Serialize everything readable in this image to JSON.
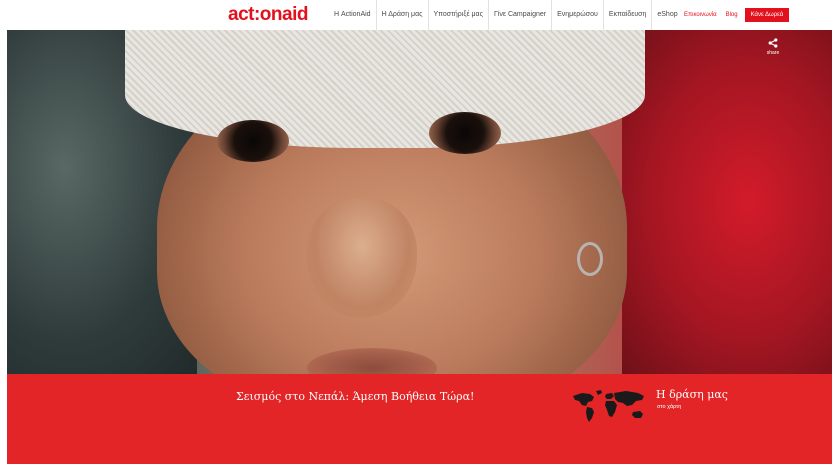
{
  "header": {
    "logo_text": "act:onaid",
    "nav": [
      "Η ActionAid",
      "Η Δράση μας",
      "Υποστήριξέ μας",
      "Γίνε Campaigner",
      "Ενημερώσου",
      "Εκπαίδευση",
      "eShop"
    ],
    "right_links": [
      "Επικοινωνία",
      "Blog"
    ],
    "donate_label": "Κάνε Δωρεά"
  },
  "hero": {
    "share_label": "share",
    "image_subject": "close-up of child with bandaged head"
  },
  "band": {
    "headline": "Σεισμός στο Νεπάλ: Άμεση Βοήθεια Τώρα!",
    "map_title": "Η δράση μας",
    "map_subtitle": "στο χάρτη"
  },
  "colors": {
    "brand_red": "#e3101d",
    "band_red": "#e42527",
    "nav_text": "#4a4a4a"
  },
  "icons": {
    "share": "share-icon",
    "world_map": "world-map-icon"
  }
}
